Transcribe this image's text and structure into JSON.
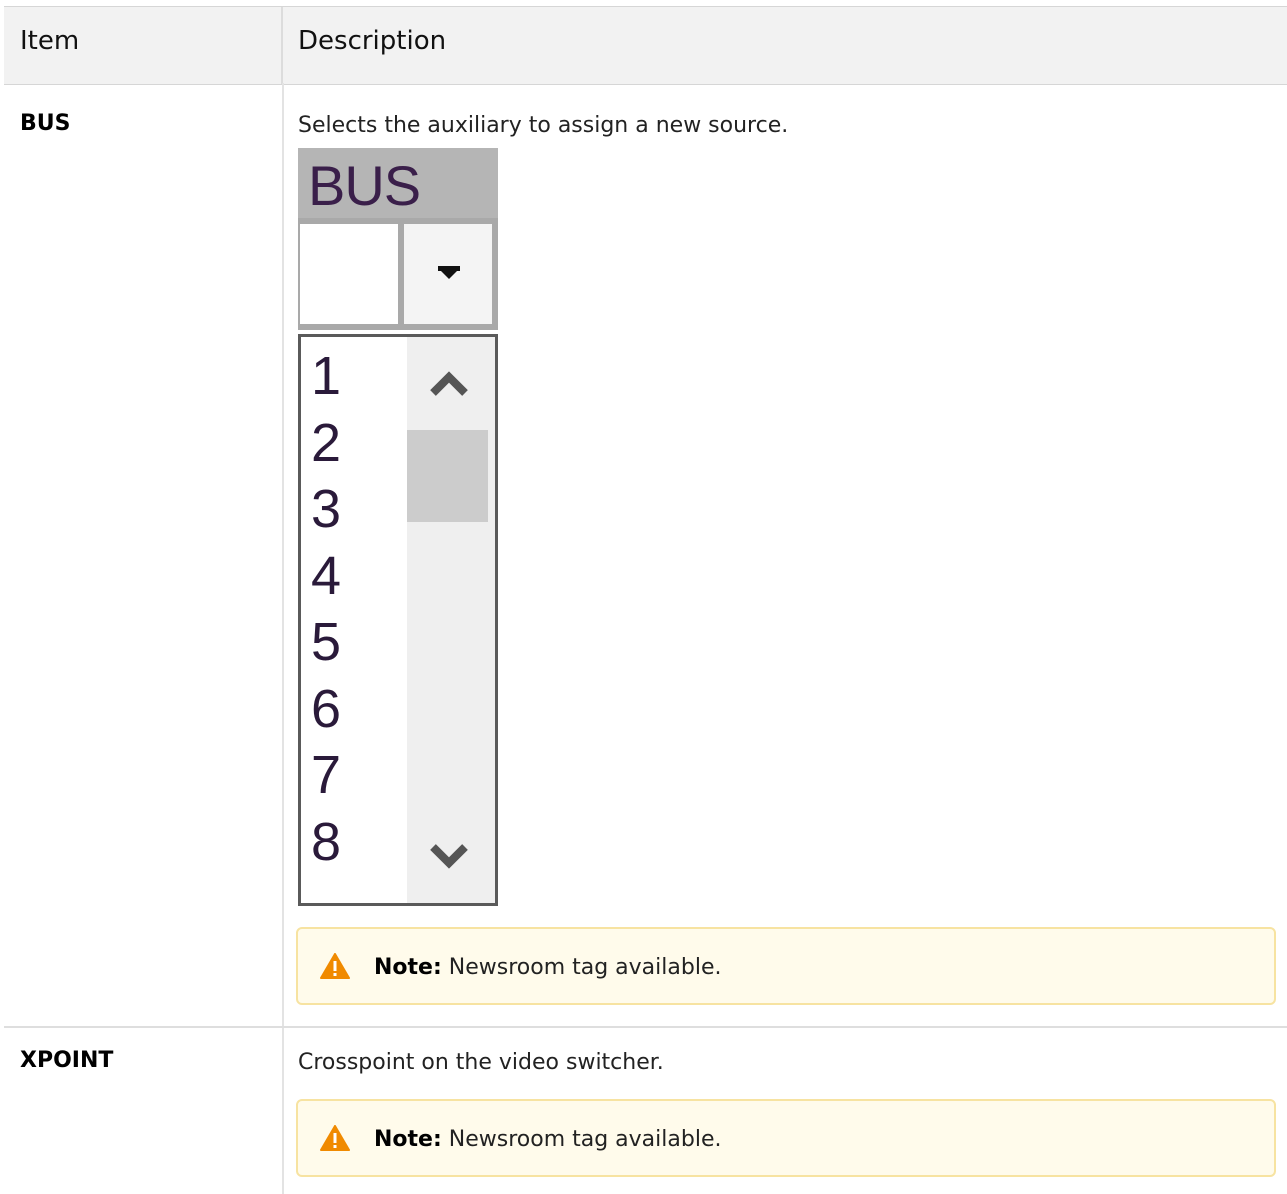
{
  "table": {
    "headers": {
      "item": "Item",
      "description": "Description"
    },
    "rows": [
      {
        "item": "BUS",
        "description": "Selects the auxiliary to assign a new source.",
        "widget": {
          "title": "BUS",
          "combo_value": "",
          "list_items": [
            "1",
            "2",
            "3",
            "4",
            "5",
            "6",
            "7",
            "8"
          ]
        },
        "note": {
          "label": "Note:",
          "text": "Newsroom tag available."
        }
      },
      {
        "item": "XPOINT",
        "description": "Crosspoint on the video switcher.",
        "note": {
          "label": "Note:",
          "text": "Newsroom tag available."
        }
      }
    ]
  },
  "colors": {
    "note_background": "#fffbeb",
    "note_border": "#f7e3a1",
    "warning_icon": "#f08a00",
    "header_background": "#f2f2f2"
  },
  "icons": {
    "warning": "warning-icon",
    "dropdown": "chevron-down-icon",
    "scroll_up": "scroll-up-icon",
    "scroll_down": "scroll-down-icon"
  }
}
